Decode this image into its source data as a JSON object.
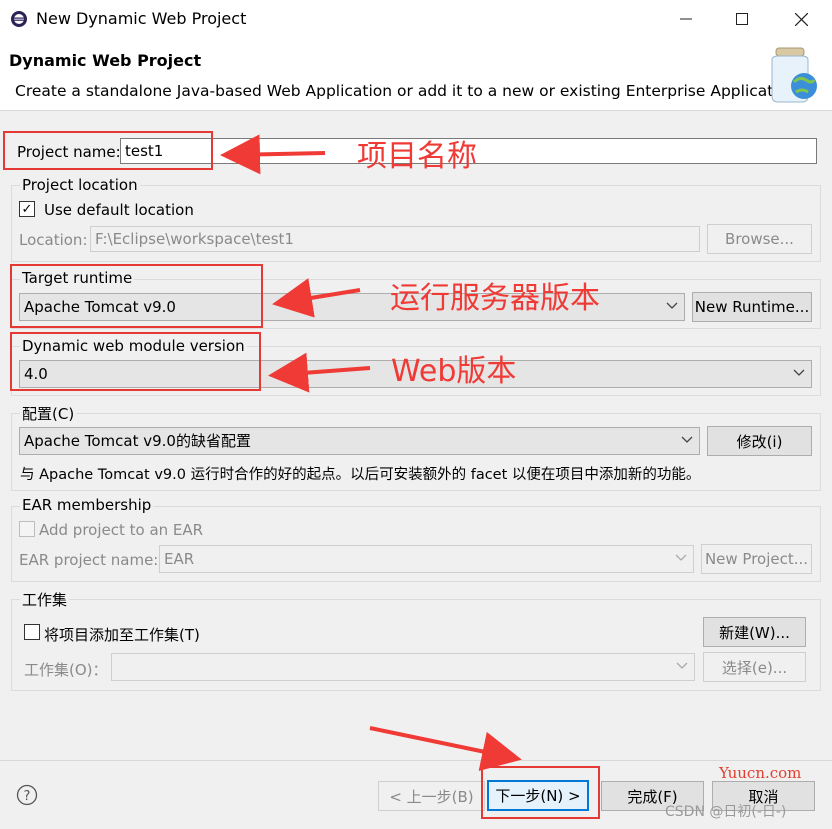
{
  "window": {
    "title": "New Dynamic Web Project"
  },
  "header": {
    "title": "Dynamic Web Project",
    "description": "Create a standalone Java-based Web Application or add it to a new or existing Enterprise Application."
  },
  "project_name": {
    "label": "Project name:",
    "value": "test1"
  },
  "project_location": {
    "group_label": "Project location",
    "use_default_label": "Use default location",
    "use_default_checked": true,
    "location_label": "Location:",
    "location_value": "F:\\Eclipse\\workspace\\test1",
    "browse_label": "Browse..."
  },
  "target_runtime": {
    "label": "Target runtime",
    "value": "Apache Tomcat v9.0",
    "new_runtime_label": "New Runtime..."
  },
  "module_version": {
    "label": "Dynamic web module version",
    "value": "4.0"
  },
  "configuration": {
    "label": "配置(C)",
    "value": "Apache Tomcat v9.0的缺省配置",
    "modify_label": "修改(i)",
    "description": "与 Apache Tomcat v9.0 运行时合作的好的起点。以后可安装额外的 facet 以便在项目中添加新的功能。"
  },
  "ear": {
    "group_label": "EAR membership",
    "add_label": "Add project to an EAR",
    "name_label": "EAR project name:",
    "name_value": "EAR",
    "new_project_label": "New Project..."
  },
  "working_sets": {
    "group_label": "工作集",
    "add_label": "将项目添加至工作集(T)",
    "new_label": "新建(W)...",
    "sets_label": "工作集(O)：",
    "select_label": "选择(e)..."
  },
  "footer": {
    "back_label": "< 上一步(B)",
    "next_label": "下一步(N) >",
    "finish_label": "完成(F)",
    "cancel_label": "取消"
  },
  "annotations": {
    "project_name": "项目名称",
    "runtime": "运行服务器版本",
    "web_version": "Web版本"
  },
  "watermarks": {
    "site": "Yuucn.com",
    "csdn": "CSDN @日初(-日-)"
  },
  "colors": {
    "annotation_red": "#ef3a36",
    "accent_blue": "#0078d7"
  }
}
